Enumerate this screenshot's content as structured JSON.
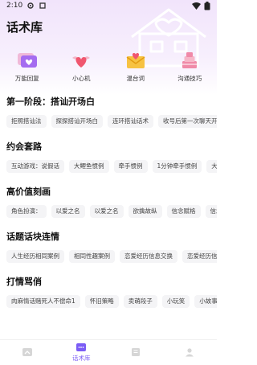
{
  "status": {
    "time": "2:10"
  },
  "page_title": "话术库",
  "quick_items": [
    {
      "label": "万能回复",
      "icon": "chat-bubble-heart-icon"
    },
    {
      "label": "小心机",
      "icon": "winged-heart-icon"
    },
    {
      "label": "温台词",
      "icon": "love-letter-icon"
    },
    {
      "label": "沟通技巧",
      "icon": "cake-icon"
    }
  ],
  "sections": [
    {
      "title": "第一阶段：搭讪开场白",
      "chips": [
        "拒照搭讪法",
        "探探搭讪开场白",
        "连环搭讪话术",
        "收号后第一次聊天开"
      ]
    },
    {
      "title": "约会套路",
      "chips": [
        "互动游戏：说假话",
        "大鲤鱼惯例",
        "牵手惯例",
        "1分钟牵手惯例",
        "大"
      ]
    },
    {
      "title": "高价值刻画",
      "chips": [
        "角色扮演：",
        "以爱之名",
        "以爱之名",
        "欲擒故纵",
        "信念赋格",
        "信念"
      ]
    },
    {
      "title": "话题话块连情",
      "chips": [
        "人生经历相同案例",
        "相同性趣案例",
        "恋爱经历信息交换",
        "恋爱经历信息"
      ]
    },
    {
      "title": "打情骂俏",
      "chips": [
        "肉麻情话赌死人不偿命1",
        "怀旧策略",
        "卖萌段子",
        "小玩笑",
        "小故事"
      ]
    }
  ],
  "tabs": [
    {
      "label": "",
      "icon": "home-icon",
      "active": false
    },
    {
      "label": "话术库",
      "icon": "chat-icon",
      "active": true
    },
    {
      "label": "",
      "icon": "book-icon",
      "active": false
    },
    {
      "label": "",
      "icon": "profile-icon",
      "active": false
    }
  ],
  "colors": {
    "accent": "#7b5cf5",
    "chip_bg": "#f4f4f6",
    "header_bg": "#f1e4fb"
  }
}
